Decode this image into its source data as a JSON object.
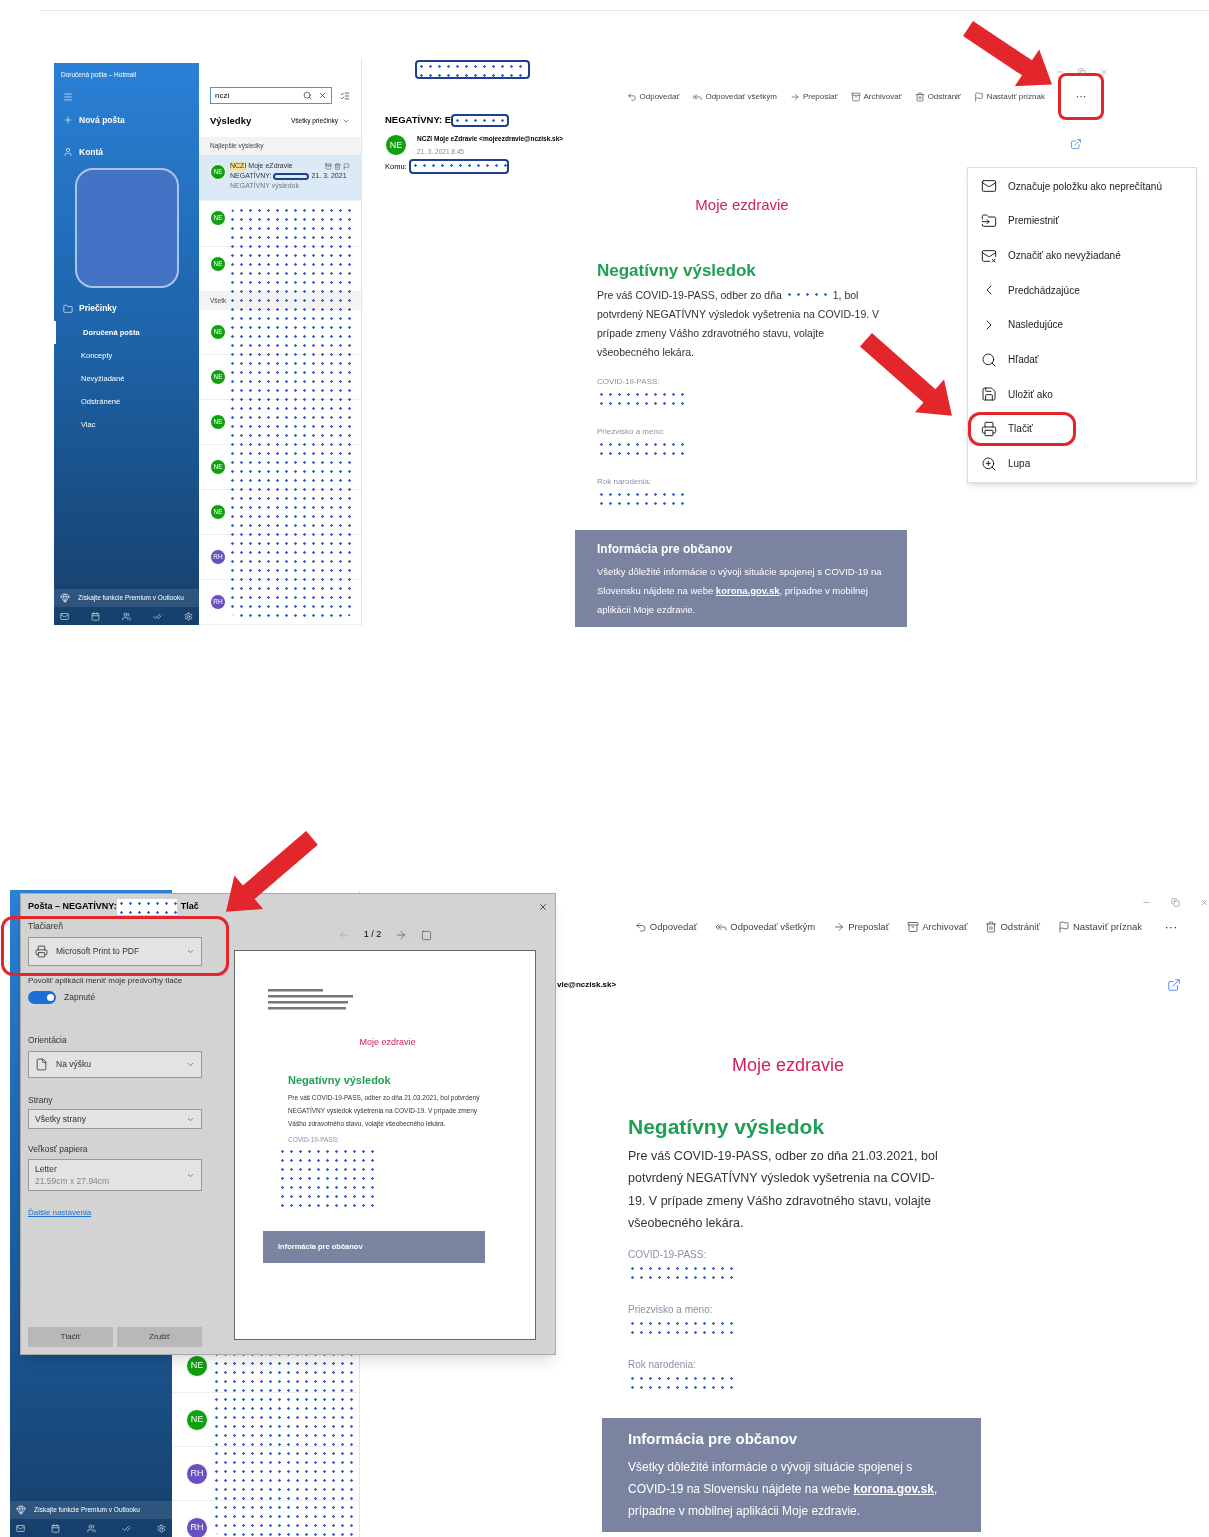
{
  "top_screen": {
    "sidebar": {
      "title": "Doručená pošta – Hotmail",
      "new_mail": "Nová pošta",
      "accounts": "Kontá",
      "folders_heading": "Priečinky",
      "folders": [
        {
          "label": "Doručená pošta",
          "selected": true
        },
        {
          "label": "Koncepty",
          "selected": false
        },
        {
          "label": "Nevyžiadané",
          "selected": false
        },
        {
          "label": "Odstránené",
          "selected": false
        },
        {
          "label": "Viac",
          "selected": false
        }
      ],
      "premium": "Získajte funkcie Premium v Outlooku"
    },
    "message_list": {
      "search": {
        "value": "nczi"
      },
      "heading": "Výsledky",
      "filter": "Všetky priečinky",
      "best_label": "Najlepšie výsledky",
      "all_label": "Všetk",
      "best_items": [
        {
          "initials": "NE",
          "color": "#10a010",
          "selected": true,
          "sender_match": "NCZI",
          "sender": "Moje eZdravie",
          "subject": "NEGATÍVNY:",
          "date": "21. 3. 2021",
          "preview": "NEGATÍVNY výsledok"
        },
        {
          "initials": "NE",
          "color": "#10a010",
          "selected": false
        },
        {
          "initials": "NE",
          "color": "#10a010",
          "selected": false
        }
      ],
      "all_items": [
        {
          "initials": "NE",
          "color": "#10a010",
          "selected": false
        },
        {
          "initials": "NE",
          "color": "#10a010",
          "selected": false
        },
        {
          "initials": "NE",
          "color": "#10a010",
          "selected": false
        },
        {
          "initials": "NE",
          "color": "#10a010",
          "selected": false
        },
        {
          "initials": "NE",
          "color": "#10a010",
          "selected": false
        },
        {
          "initials": "RH",
          "color": "#6a4fc0",
          "selected": false
        },
        {
          "initials": "RH",
          "color": "#6a4fc0",
          "selected": false
        }
      ]
    },
    "reading_pane": {
      "toolbar": [
        {
          "kind": "reply",
          "label": "Odpovedať"
        },
        {
          "kind": "reply_all",
          "label": "Odpovedať všetkým"
        },
        {
          "kind": "forward",
          "label": "Preposlať"
        },
        {
          "kind": "archive",
          "label": "Archivovať"
        },
        {
          "kind": "delete",
          "label": "Odstrániť"
        },
        {
          "kind": "flag",
          "label": "Nastaviť príznak"
        }
      ],
      "more": {
        "label": "···",
        "highlighted": true
      },
      "subject": "NEGATÍVNY: E",
      "initials": "NE",
      "sender": "NCZI Moje eZdravie <mojeezdravie@nczisk.sk>",
      "date": "21. 3. 2021 8:45",
      "to_label": "Komu:",
      "body": {
        "brand": "Moje ezdravie",
        "heading": "Negatívny výsledok",
        "text_before_date": "Pre váš COVID-19-PASS, odber zo dňa ",
        "text_after_date": "1, bol",
        "text_continued": "potvrdený NEGATÍVNY výsledok vyšetrenia na COVID-19. V prípade zmeny Vášho zdravotného stavu, volajte všeobecného lekára.",
        "fields": [
          "COVID-19-PASS:",
          "Priezvisko a meno:",
          "Rok narodenia:"
        ],
        "info": {
          "title": "Informácia pre občanov",
          "text_before": "Všetky dôležité informácie o vývoji situácie spojenej s COVID-19 na Slovensku nájdete na webe ",
          "link": "korona.gov.sk",
          "text_after": ", prípadne v mobilnej aplikácii Moje ezdravie."
        }
      }
    },
    "menu": [
      {
        "kind": "unread",
        "label": "Označuje položku ako neprečítanú",
        "highlighted": false
      },
      {
        "kind": "move",
        "label": "Premiestniť",
        "highlighted": false
      },
      {
        "kind": "junk",
        "label": "Označiť ako nevyžiadané",
        "highlighted": false
      },
      {
        "kind": "previous",
        "label": "Predchádzajúce",
        "highlighted": false
      },
      {
        "kind": "next",
        "label": "Nasledujúce",
        "highlighted": false
      },
      {
        "kind": "search",
        "label": "Hľadať",
        "highlighted": false
      },
      {
        "kind": "save",
        "label": "Uložiť ako",
        "highlighted": false
      },
      {
        "kind": "print",
        "label": "Tlačiť",
        "highlighted": true
      },
      {
        "kind": "zoom",
        "label": "Lupa",
        "highlighted": false
      }
    ]
  },
  "bottom_screen": {
    "sidebar": {
      "premium": "Získajte funkcie Premium v Outlooku"
    },
    "message_list": {
      "items": [
        {
          "initials": "NE",
          "color": "#10a010"
        },
        {
          "initials": "NE",
          "color": "#10a010"
        },
        {
          "initials": "RH",
          "color": "#6a4fc0"
        },
        {
          "initials": "RH",
          "color": "#6a4fc0"
        }
      ]
    },
    "reading_pane": {
      "toolbar": [
        {
          "kind": "reply",
          "label": "Odpovedať"
        },
        {
          "kind": "reply_all",
          "label": "Odpovedať všetkým"
        },
        {
          "kind": "forward",
          "label": "Preposlať"
        },
        {
          "kind": "archive",
          "label": "Archivovať"
        },
        {
          "kind": "delete",
          "label": "Odstrániť"
        },
        {
          "kind": "flag",
          "label": "Nastaviť príznak"
        }
      ],
      "more": {
        "label": "···",
        "highlighted": false
      },
      "sender_fragment": "vie@nczisk.sk>",
      "body": {
        "brand": "Moje ezdravie",
        "heading": "Negatívny výsledok",
        "text_before_date": "Pre váš COVID-19-PASS, odber zo dňa ",
        "date": "21.03.2021",
        "text_after_date": ", bol potvrdený NEGATÍVNY výsledok vyšetrenia na COVID-19. V prípade zmeny Vášho zdravotného stavu, volajte všeobecného lekára.",
        "fields": [
          "COVID-19-PASS:",
          "Priezvisko a meno:",
          "Rok narodenia:"
        ],
        "info": {
          "title": "Informácia pre občanov",
          "text_before": "Všetky dôležité informácie o vývoji situácie spojenej s COVID-19 na Slovensku nájdete na webe ",
          "link": "korona.gov.sk",
          "text_after": ", prípadne v mobilnej aplikácii Moje ezdravie."
        }
      }
    },
    "print_dialog": {
      "title_prefix": "Pošta – NEGATÍVNY: ",
      "title_suffix": "Tlač",
      "printer": {
        "label": "Tlačiareň",
        "value": "Microsoft Print to PDF",
        "highlighted": true
      },
      "permission_label": "Povoliť aplikácii meniť moje predvoľby tlače",
      "permission_toggle": {
        "on": true,
        "label": "Zapnuté"
      },
      "orientation": {
        "label": "Orientácia",
        "value": "Na výšku"
      },
      "pages": {
        "label": "Strany",
        "value": "Všetky strany"
      },
      "paper": {
        "label": "Veľkosť papiera",
        "value": "Letter",
        "detail": "21.59cm x 27.94cm"
      },
      "more_settings": "Ďalšie nastavenia",
      "buttons": [
        "Tlačiť",
        "Zrušiť"
      ],
      "preview": {
        "page": "1 / 2",
        "brand": "Moje ezdravie",
        "heading": "Negatívny výsledok",
        "text": "Pre váš COVID-19-PASS, odber zo dňa 21.03.2021, bol potvrdený NEGATÍVNY výsledok vyšetrenia na COVID-19. V prípade zmeny Vášho zdravotného stavu, volajte všeobecného lekára.",
        "field": "COVID-19-PASS:",
        "info_title": "Informácia pre občanov"
      }
    }
  }
}
